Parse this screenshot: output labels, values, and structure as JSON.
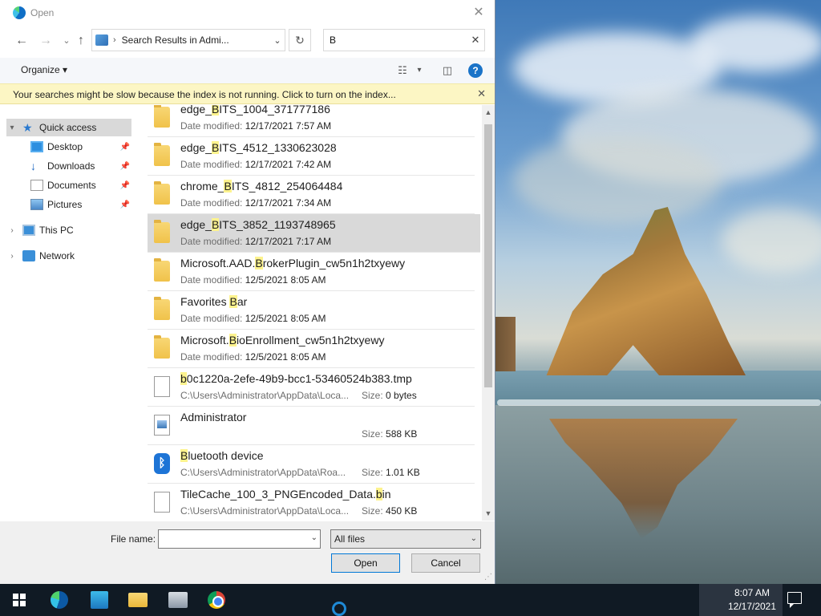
{
  "dialog": {
    "title": "Open",
    "address": "Search Results in Admi...",
    "search_value": "B",
    "organize_label": "Organize",
    "info_message": "Your searches might be slow because the index is not running.  Click to turn on the index...",
    "accent_color": "#0078d7",
    "highlight_color": "#fdf38e"
  },
  "icons": {
    "close": "✕",
    "back": "←",
    "forward": "→",
    "up": "↑",
    "refresh": "↻",
    "chevron_down": "⌄",
    "help": "?",
    "chevron_right": "›",
    "dropdown": "▾",
    "pin": "📌"
  },
  "nav": {
    "quick_access": "Quick access",
    "desktop": "Desktop",
    "downloads": "Downloads",
    "documents": "Documents",
    "pictures": "Pictures",
    "this_pc": "This PC",
    "network": "Network"
  },
  "labels": {
    "date_modified": "Date modified:",
    "size": "Size:"
  },
  "results": [
    {
      "pre": "edge_",
      "hl": "B",
      "post": "ITS_1004_371777186",
      "date": "12/17/2021 7:57 AM"
    },
    {
      "pre": "edge_",
      "hl": "B",
      "post": "ITS_4512_1330623028",
      "date": "12/17/2021 7:42 AM"
    },
    {
      "pre": "chrome_",
      "hl": "B",
      "post": "ITS_4812_254064484",
      "date": "12/17/2021 7:34 AM"
    },
    {
      "pre": "edge_",
      "hl": "B",
      "post": "ITS_3852_1193748965",
      "date": "12/17/2021 7:17 AM"
    },
    {
      "pre": "Microsoft.AAD.",
      "hl": "B",
      "post": "rokerPlugin_cw5n1h2txyewy",
      "date": "12/5/2021 8:05 AM"
    },
    {
      "pre": "Favorites ",
      "hl": "B",
      "post": "ar",
      "date": "12/5/2021 8:05 AM"
    },
    {
      "pre": "Microsoft.",
      "hl": "B",
      "post": "ioEnrollment_cw5n1h2txyewy",
      "date": "12/5/2021 8:05 AM"
    },
    {
      "pre": "",
      "hl": "b",
      "post": "0c1220a-2efe-49b9-bcc1-53460524b383.tmp",
      "path": "C:\\Users\\Administrator\\AppData\\Loca...",
      "size": "0 bytes"
    },
    {
      "pre": "Administrator",
      "hl": "",
      "post": "",
      "size": "588 KB"
    },
    {
      "pre": "",
      "hl": "B",
      "post": "luetooth device",
      "path": "C:\\Users\\Administrator\\AppData\\Roa...",
      "size": "1.01 KB"
    },
    {
      "pre": "TileCache_100_3_PNGEncoded_Data.",
      "hl": "b",
      "post": "in",
      "path": "C:\\Users\\Administrator\\AppData\\Loca...",
      "size": "450 KB"
    }
  ],
  "bottom": {
    "file_name_label": "File name:",
    "file_name_value": "",
    "file_type": "All files",
    "open_label": "Open",
    "cancel_label": "Cancel"
  },
  "taskbar": {
    "time": "8:07 AM",
    "date": "12/17/2021"
  }
}
